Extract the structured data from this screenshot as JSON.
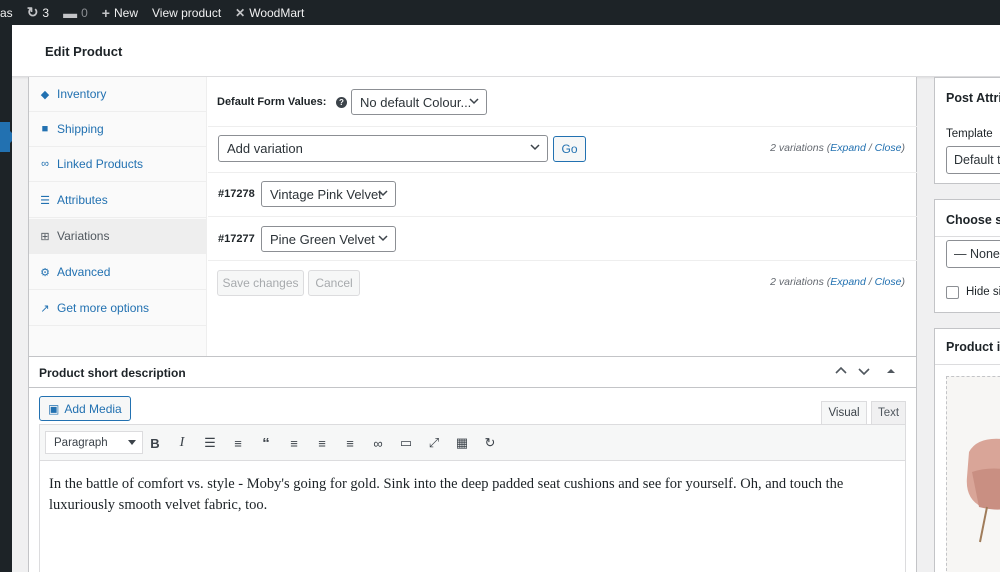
{
  "admin_bar": {
    "site_fragment": "as",
    "updates_count": "3",
    "comments_count": "0",
    "new_label": "New",
    "view_product_label": "View product",
    "woodmart_label": "WoodMart"
  },
  "header": {
    "title": "Edit Product"
  },
  "product_data": {
    "tabs": [
      {
        "label": "Inventory",
        "icon": "tag-icon"
      },
      {
        "label": "Shipping",
        "icon": "truck-icon"
      },
      {
        "label": "Linked Products",
        "icon": "link-icon"
      },
      {
        "label": "Attributes",
        "icon": "list-icon"
      },
      {
        "label": "Variations",
        "icon": "grid-icon",
        "active": true
      },
      {
        "label": "Advanced",
        "icon": "gear-icon"
      },
      {
        "label": "Get more options",
        "icon": "plug-icon"
      }
    ],
    "default_form_values_label": "Default Form Values:",
    "default_colour_value": "No default Colour...",
    "add_variation_value": "Add variation",
    "go_label": "Go",
    "variations_count_text": "2 variations",
    "expand_label": "Expand",
    "close_label": "Close",
    "variations": [
      {
        "id": "#17278",
        "value": "Vintage Pink Velvet"
      },
      {
        "id": "#17277",
        "value": "Pine Green Velvet"
      }
    ],
    "save_changes_label": "Save changes",
    "cancel_label": "Cancel"
  },
  "short_description": {
    "title": "Product short description",
    "add_media_label": "Add Media",
    "visual_tab": "Visual",
    "text_tab": "Text",
    "format_value": "Paragraph",
    "content": "In the battle of comfort vs. style - Moby's going for gold. Sink into the deep padded seat cushions and see for yourself. Oh, and touch the luxuriously smooth velvet fabric, too."
  },
  "sidebar": {
    "post_attributes_title": "Post Attrib",
    "template_label": "Template",
    "template_value": "Default t",
    "size_title": "Choose siz",
    "size_value": "— None",
    "hide_label": "Hide si",
    "product_image_title": "Product in"
  },
  "colors": {
    "accent": "#2271b1",
    "admin_bar": "#1d2327",
    "background": "#f0f0f1"
  }
}
